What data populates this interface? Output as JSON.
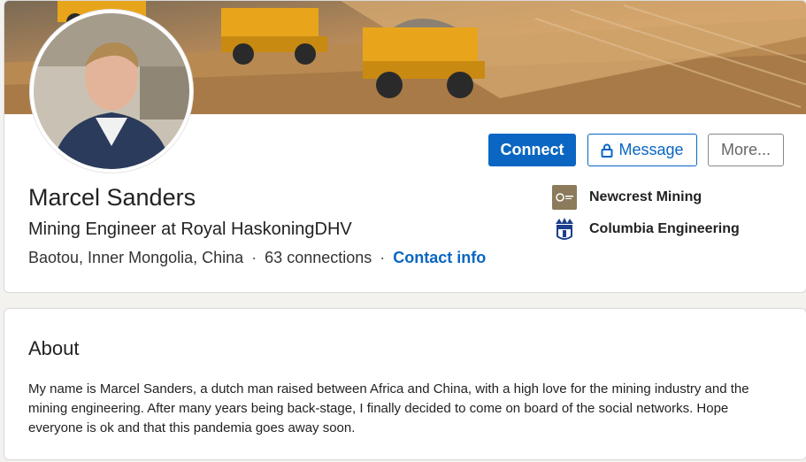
{
  "profile": {
    "name": "Marcel Sanders",
    "headline": "Mining Engineer at Royal HaskoningDHV",
    "location": "Baotou, Inner Mongolia, China",
    "connections": "63 connections",
    "contact_link": "Contact info"
  },
  "actions": {
    "connect_label": "Connect",
    "message_label": "Message",
    "more_label": "More..."
  },
  "experience": [
    {
      "name": "Newcrest Mining",
      "icon": "newcrest-logo-icon"
    },
    {
      "name": "Columbia Engineering",
      "icon": "columbia-crown-logo-icon"
    }
  ],
  "about": {
    "title": "About",
    "text": "My name is Marcel Sanders, a dutch man raised between Africa and China, with a high love for the mining industry and the mining engineering. After many years being back-stage, I finally decided to come on board of the social networks. Hope everyone is ok and that this pandemia goes away soon."
  },
  "colors": {
    "accent": "#0a66c2",
    "banner_tone": "#c9935a",
    "truck_yellow": "#e8a51c"
  }
}
